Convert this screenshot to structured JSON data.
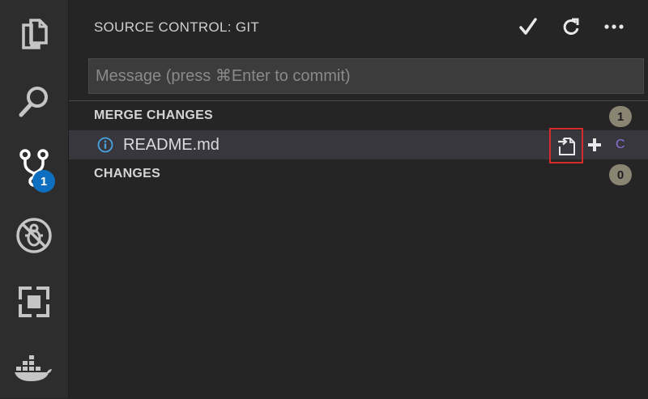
{
  "activity_bar": {
    "items": [
      {
        "name": "explorer",
        "icon": "files-icon"
      },
      {
        "name": "search",
        "icon": "search-icon"
      },
      {
        "name": "source-control",
        "icon": "git-branch-icon",
        "badge": "1"
      },
      {
        "name": "debug",
        "icon": "no-bug-icon"
      },
      {
        "name": "extensions",
        "icon": "extensions-icon"
      },
      {
        "name": "docker",
        "icon": "docker-whale-icon"
      }
    ]
  },
  "sidebar": {
    "title": "SOURCE CONTROL: GIT",
    "actions": [
      {
        "name": "commit",
        "icon": "check-icon"
      },
      {
        "name": "refresh",
        "icon": "refresh-icon"
      },
      {
        "name": "more",
        "icon": "ellipsis-icon"
      }
    ],
    "commit_input": {
      "value": "",
      "placeholder": "Message (press ⌘Enter to commit)"
    },
    "groups": [
      {
        "label": "MERGE CHANGES",
        "count": "1",
        "files": [
          {
            "name": "README.md",
            "icon": "info-icon",
            "status": "C",
            "actions": [
              "open-file-icon",
              "plus-icon"
            ]
          }
        ]
      },
      {
        "label": "CHANGES",
        "count": "0",
        "files": []
      }
    ]
  },
  "colors": {
    "background": "#252526",
    "activity_bar": "#2d2d2d",
    "badge_blue": "#0e6fc0",
    "count_badge": "#8a8473",
    "selected_row": "#37373d",
    "highlight_box": "#d42b2b",
    "status_conflict": "#8a72d6",
    "info_icon": "#4aa3df"
  }
}
